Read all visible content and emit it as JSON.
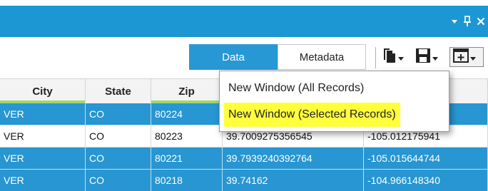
{
  "titlebar": {
    "icons": [
      "dropdown-arrow-icon",
      "pin-icon",
      "close-icon"
    ]
  },
  "tabs": {
    "data_label": "Data",
    "metadata_label": "Metadata"
  },
  "toolbar": {
    "icons": [
      "copy-icon",
      "save-icon",
      "new-window-icon"
    ]
  },
  "table": {
    "columns": [
      "City",
      "State",
      "Zip",
      "",
      ""
    ],
    "rows": [
      {
        "selected": true,
        "cells": [
          "VER",
          "CO",
          "80224",
          "",
          ""
        ]
      },
      {
        "selected": false,
        "cells": [
          "VER",
          "CO",
          "80223",
          "39.7009275356545",
          "-105.012175941"
        ]
      },
      {
        "selected": true,
        "cells": [
          "VER",
          "CO",
          "80221",
          "39.7939240392764",
          "-105.015644744"
        ]
      },
      {
        "selected": true,
        "cells": [
          "VER",
          "CO",
          "80218",
          "39.74162",
          "-104.966148340"
        ]
      }
    ]
  },
  "menu": {
    "items": [
      {
        "label": "New Window (All Records)",
        "highlighted": false
      },
      {
        "label": "New Window (Selected Records)",
        "highlighted": true
      }
    ]
  },
  "colors": {
    "titlebar": "#1d97d4",
    "selected_row": "#2796d2",
    "active_tab": "#2898d4",
    "menu_highlight": "#ffff3c",
    "header_underline": "#9ed96a"
  }
}
